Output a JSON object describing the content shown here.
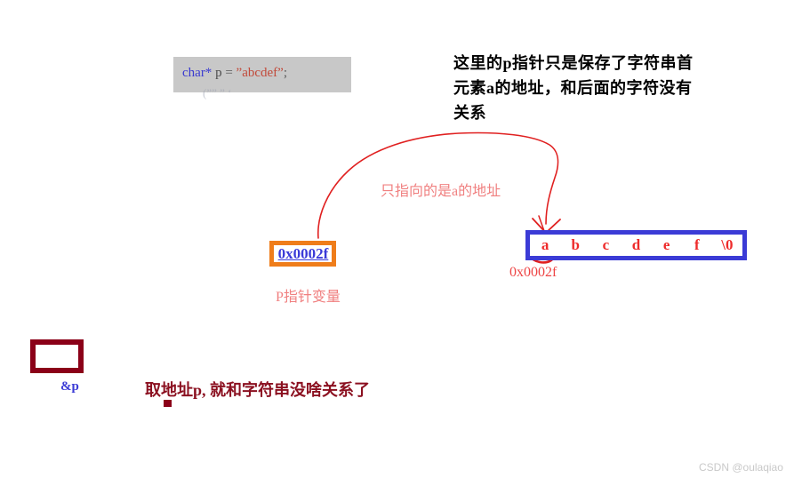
{
  "code": {
    "line1": {
      "keyword": "char*",
      "space1": " ",
      "var": "p",
      "operator": " = ",
      "string": "”abcdef”",
      "semicolon": ";"
    },
    "line2_faded": "(””        ”          ‘"
  },
  "notes": {
    "top_right_line1": "这里的p指针只是保存了字符串首",
    "top_right_line2": "元素a的地址，和后面的字符没有",
    "top_right_line3": "关系",
    "curve_label": "只指向的是a的地址",
    "bottom": "取地址p, 就和字符串没啥关系了"
  },
  "pointer_box": {
    "value": "0x0002f",
    "caption": "P指针变量",
    "border_color": "#ef7d1a",
    "text_color": "#3a3ad8"
  },
  "string_box": {
    "cells": [
      "a",
      "b",
      "c",
      "d",
      "e",
      "f",
      "\\0"
    ],
    "address": "0x0002f",
    "border_color": "#3b3bd6",
    "text_color": "#ee2b2b",
    "highlighted_cell": "a"
  },
  "amp_box": {
    "label": "&p",
    "border_color": "#8b0018",
    "label_color": "#3b3bd6"
  },
  "watermark": {
    "text": "CSDN @oulaqiao"
  },
  "colors": {
    "annotation_red": "#ee2b2b",
    "light_red": "#f08080",
    "dark_red": "#8b1020",
    "blue": "#3b3bd6",
    "orange": "#ef7d1a"
  }
}
